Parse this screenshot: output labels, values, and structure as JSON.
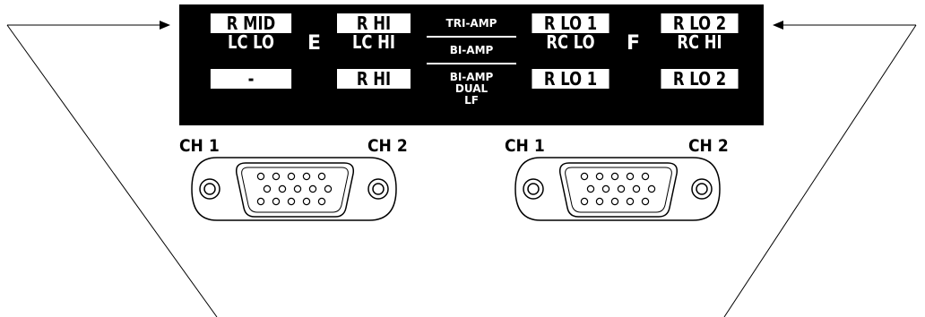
{
  "panel": {
    "bank_e": "E",
    "bank_f": "F",
    "bank_e_col1": [
      "R MID",
      "LC LO",
      "-"
    ],
    "bank_e_col2": [
      "R HI",
      "LC HI",
      "R HI"
    ],
    "bank_f_col1": [
      "R LO 1",
      "RC LO",
      "R LO 1"
    ],
    "bank_f_col2": [
      "R LO 2",
      "RC HI",
      "R LO 2"
    ],
    "modes": {
      "tri_amp": "TRI-AMP",
      "bi_amp": "BI-AMP",
      "bi_amp_dual": "BI-AMP",
      "dual": "DUAL",
      "lf": "LF"
    }
  },
  "connectors": {
    "e": {
      "ch1": "CH 1",
      "ch2": "CH 2"
    },
    "f": {
      "ch1": "CH 1",
      "ch2": "CH 2"
    }
  }
}
